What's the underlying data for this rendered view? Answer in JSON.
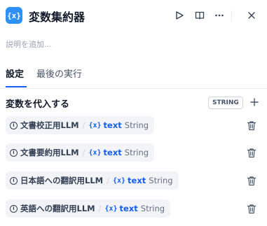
{
  "header": {
    "icon_text": "{x}",
    "title": "変数集約器",
    "buttons": [
      "play-icon",
      "book-icon",
      "more-icon",
      "close-icon"
    ]
  },
  "description_placeholder": "説明を追加...",
  "tabs": [
    {
      "label": "設定",
      "active": true
    },
    {
      "label": "最後の実行",
      "active": false
    }
  ],
  "section": {
    "title": "変数を代入する",
    "type_badge": "STRING"
  },
  "variables": [
    {
      "node": "文書校正用LLM",
      "var_icon": "{x}",
      "var": "text",
      "type": "String"
    },
    {
      "node": "文書要約用LLM",
      "var_icon": "{x}",
      "var": "text",
      "type": "String"
    },
    {
      "node": "日本語への翻訳用LLM",
      "var_icon": "{x}",
      "var": "text",
      "type": "String"
    },
    {
      "node": "英語への翻訳用LLM",
      "var_icon": "{x}",
      "var": "text",
      "type": "String"
    }
  ],
  "colors": {
    "accent": "#2e90fa",
    "link": "#155eef"
  }
}
